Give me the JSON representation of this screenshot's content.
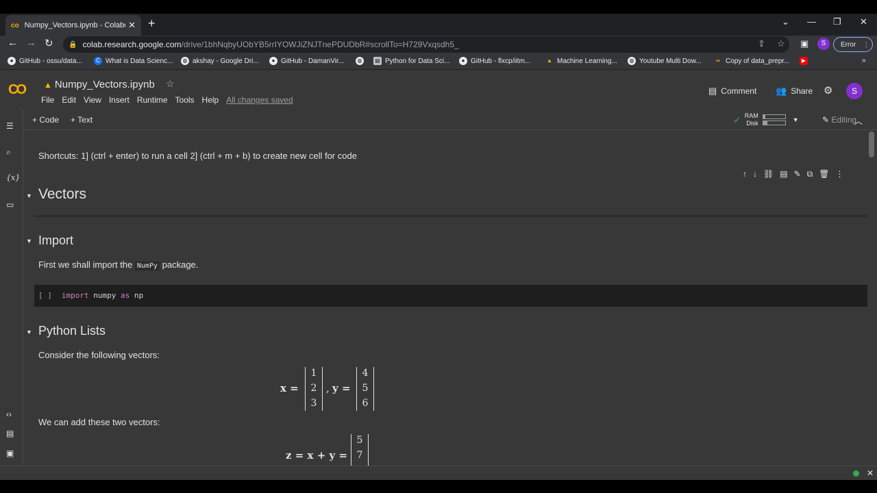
{
  "browser": {
    "tab_title": "Numpy_Vectors.ipynb - Colabora",
    "tab_favicon": "co",
    "url_host": "colab.research.google.com",
    "url_path": "/drive/1bhNqbyUObYB5rrIYOWJiZNJTnePDUDbR#scrollTo=H729Vxqsdh5_",
    "profile_initial": "S",
    "error_label": "Error",
    "bookmarks": [
      {
        "label": "GitHub - ossu/data...",
        "icon": "github-icon"
      },
      {
        "label": "What is Data Scienc...",
        "icon": "c-icon"
      },
      {
        "label": "akshay - Google Dri...",
        "icon": "globe-icon"
      },
      {
        "label": "GitHub - DamanVir...",
        "icon": "github-icon"
      },
      {
        "label": "",
        "icon": "globe-icon"
      },
      {
        "label": "Python for Data Sci...",
        "icon": "page-icon"
      },
      {
        "label": "GitHub - flxcp/iitm...",
        "icon": "github-icon"
      },
      {
        "label": "Machine Learning...",
        "icon": "drive-icon"
      },
      {
        "label": "Youtube Multi Dow...",
        "icon": "globe-icon"
      },
      {
        "label": "Copy of data_prepr...",
        "icon": "colab-icon"
      },
      {
        "label": "",
        "icon": "youtube-icon"
      }
    ]
  },
  "colab": {
    "logo": "CO",
    "notebook_title": "Numpy_Vectors.ipynb",
    "menu": [
      "File",
      "Edit",
      "View",
      "Insert",
      "Runtime",
      "Tools",
      "Help"
    ],
    "saved_status": "All changes saved",
    "comment_label": "Comment",
    "share_label": "Share",
    "avatar_initial": "S",
    "add_code_label": "+ Code",
    "add_text_label": "+ Text",
    "ram_label": "RAM",
    "disk_label": "Disk",
    "ram_fraction": 0.1,
    "disk_fraction": 0.2,
    "editing_label": "Editing"
  },
  "notebook": {
    "shortcuts_text": "Shortcuts: 1] (ctrl + enter) to run a cell 2] (ctrl + m + b) to create new cell for code",
    "vectors_heading": "Vectors",
    "import_heading": "Import",
    "import_text_before": "First we shall import the",
    "import_inline_code": "NumPy",
    "import_text_after": "package.",
    "code_brackets": "[ ]",
    "code_kw1": "import",
    "code_mod": "numpy",
    "code_kw2": "as",
    "code_alias": "np",
    "lists_heading": "Python Lists",
    "consider_text": "Consider the following vectors:",
    "x_label": "x =",
    "x_values": [
      "1",
      "2",
      "3"
    ],
    "comma": ",",
    "y_label": "y =",
    "y_values": [
      "4",
      "5",
      "6"
    ],
    "add_text": "We can add these two vectors:",
    "z_label": "z = x + y =",
    "z_values": [
      "5",
      "7"
    ]
  }
}
